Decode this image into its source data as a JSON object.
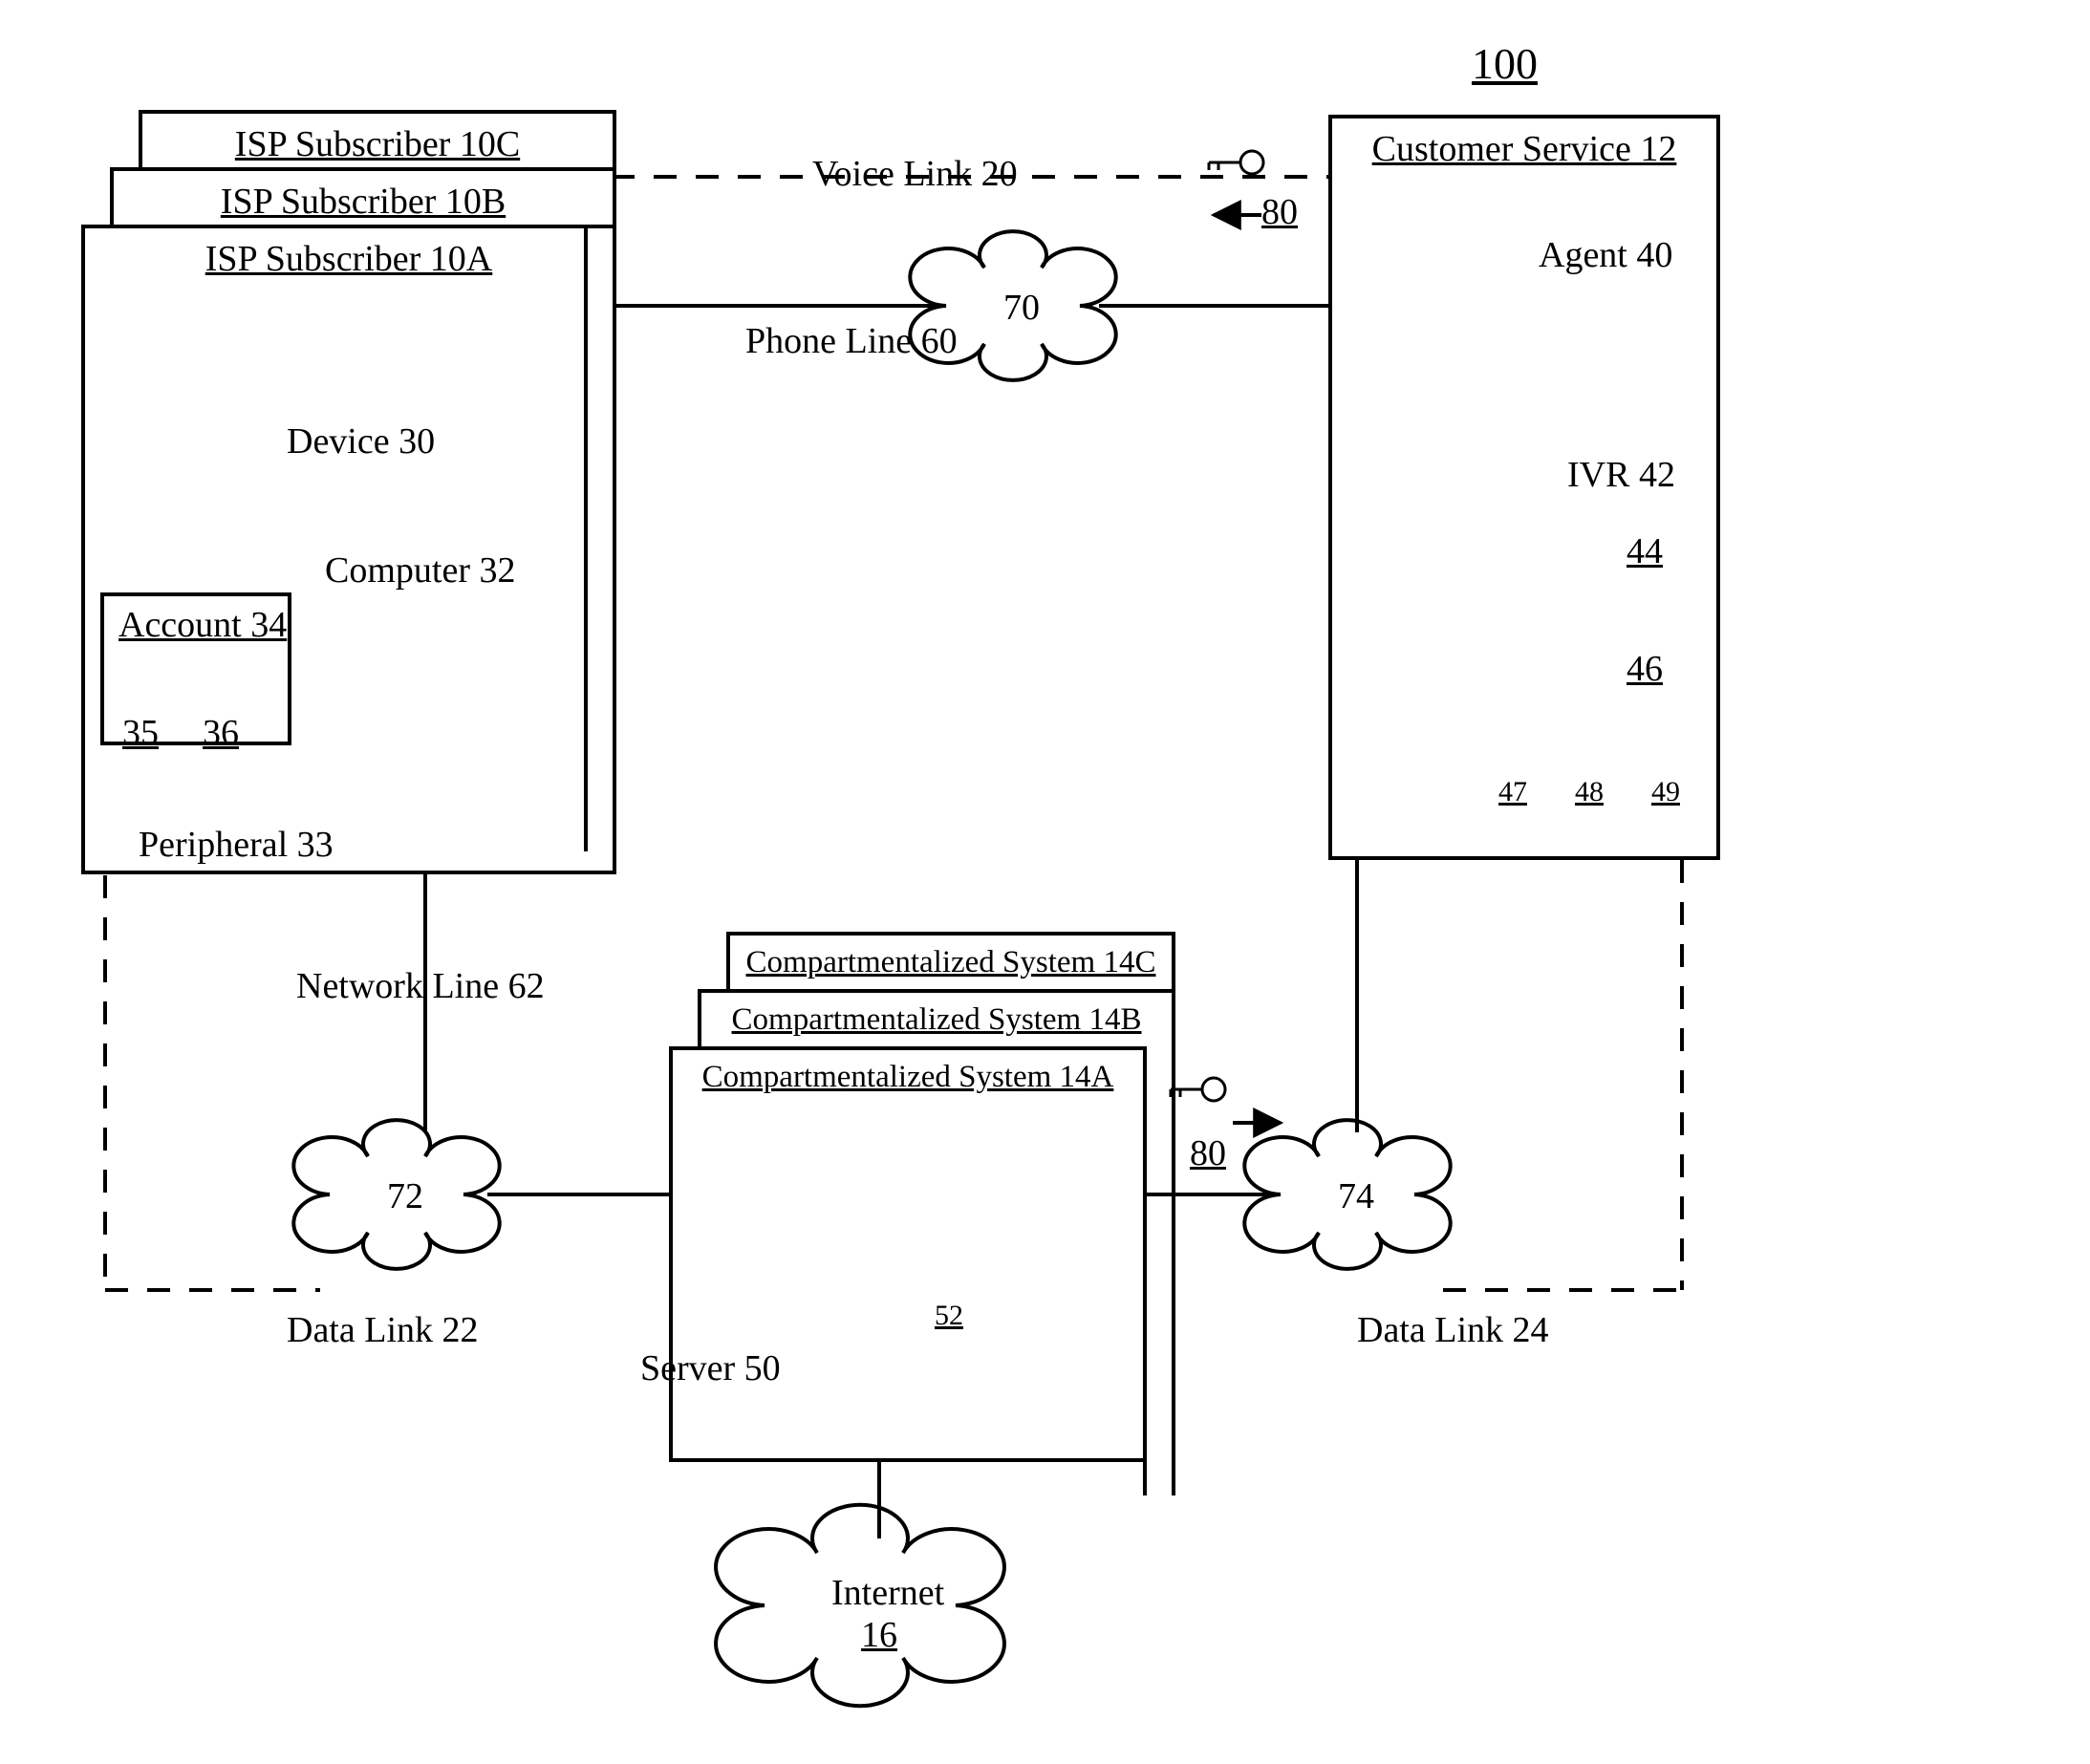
{
  "fig_number": "100",
  "subscribers": {
    "c": "ISP Subscriber 10C",
    "b": "ISP Subscriber 10B",
    "a": "ISP Subscriber 10A",
    "device": "Device 30",
    "computer": "Computer 32",
    "peripheral": "Peripheral 33",
    "account": {
      "title": "Account 34",
      "user": "35",
      "key": "36"
    }
  },
  "customer_service": {
    "title": "Customer Service 12",
    "agent": "Agent 40",
    "ivr": "IVR 42",
    "db1": "44",
    "db2": "46",
    "box1": "47",
    "box2": "48",
    "box3": "49"
  },
  "compartment": {
    "c": "Compartmentalized System 14C",
    "b": "Compartmentalized System 14B",
    "a": "Compartmentalized System 14A",
    "server": "Server 50",
    "server_db": "52"
  },
  "clouds": {
    "c70": "70",
    "c72": "72",
    "c74": "74",
    "internet": "Internet",
    "internet_num": "16"
  },
  "links": {
    "voice": "Voice Link 20",
    "phone": "Phone Line 60",
    "network": "Network Line 62",
    "data22": "Data Link 22",
    "data24": "Data Link 24"
  },
  "key80": "80"
}
